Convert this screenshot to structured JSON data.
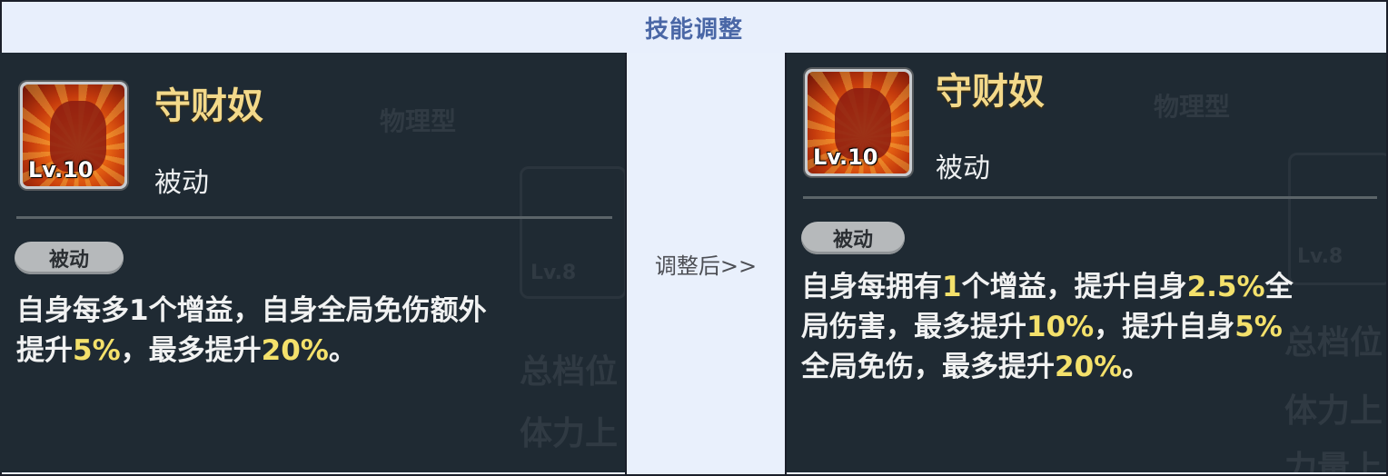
{
  "header": {
    "title": "技能调整"
  },
  "middle": {
    "label": "调整后>>"
  },
  "left": {
    "skill_name": "守财奴",
    "level": "Lv.10",
    "subtype": "被动",
    "tag": "被动",
    "desc": {
      "p1": "自身每多1个增益，自身全局免伤额外",
      "p2": "提升",
      "v1": "5%",
      "p3": "，最多提升",
      "v2": "20%",
      "p4": "。"
    },
    "bg": {
      "g1": "物理型",
      "g2": "总档位",
      "g3": "体力上",
      "g4": "Lv.8"
    }
  },
  "right": {
    "skill_name": "守财奴",
    "level": "Lv.10",
    "subtype": "被动",
    "tag": "被动",
    "desc": {
      "p1": "自身每拥有",
      "v1": "1",
      "p2": "个增益，提升自身",
      "v2": "2.5%",
      "p3": "全",
      "p4": "局伤害，最多提升",
      "v3": "10%",
      "p5": "，提升自身",
      "v4": "5%",
      "p6": "全局免伤，最多提升",
      "v5": "20%",
      "p7": "。"
    },
    "bg": {
      "g1": "物理型",
      "g2": "总档位",
      "g3": "体力上",
      "g4": "力量上",
      "g5": "Lv.8"
    }
  }
}
